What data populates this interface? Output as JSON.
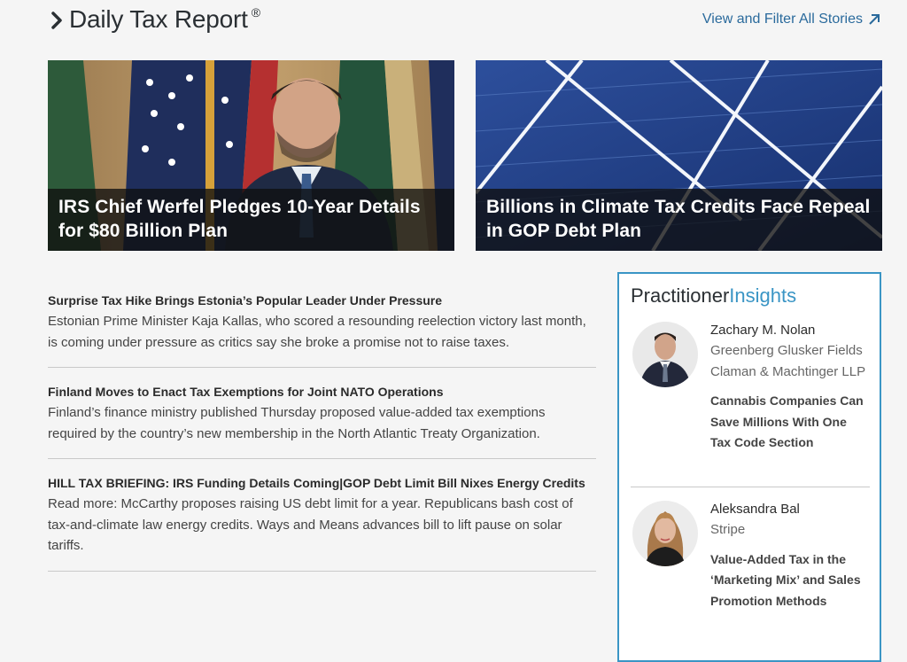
{
  "header": {
    "title": "Daily Tax Report",
    "registered": "®",
    "view_all": "View and Filter All Stories"
  },
  "featured": [
    {
      "headline": "IRS Chief Werfel Pledges 10-Year Details for $80 Billion Plan"
    },
    {
      "headline": "Billions in Climate Tax Credits Face Repeal in GOP Debt Plan"
    }
  ],
  "stories": [
    {
      "title": "Surprise Tax Hike Brings Estonia’s Popular Leader Under Pressure",
      "desc": "Estonian Prime Minister Kaja Kallas, who scored a resounding reelection victory last month, is coming under pressure as critics say she broke a promise not to raise taxes."
    },
    {
      "title": "Finland Moves to Enact Tax Exemptions for Joint NATO Operations",
      "desc": "Finland’s finance ministry published Thursday proposed value-added tax exemptions required by the country’s new membership in the North Atlantic Treaty Organization."
    },
    {
      "title": "HILL TAX BRIEFING: IRS Funding Details Coming|GOP Debt Limit Bill Nixes Energy Credits",
      "desc": "Read more: McCarthy proposes raising US debt limit for a year. Republicans bash cost of tax-and-climate law energy credits. Ways and Means advances bill to lift pause on solar tariffs."
    }
  ],
  "insights": {
    "title_a": "Practitioner",
    "title_b": "Insights",
    "people": [
      {
        "name": "Zachary M. Nolan",
        "org": "Greenberg Glusker Fields Claman & Machtinger LLP",
        "article": "Cannabis Companies Can Save Millions With One Tax Code Section"
      },
      {
        "name": "Aleksandra Bal",
        "org": "Stripe",
        "article": "Value-Added Tax in the ‘Marketing Mix’ and Sales Promotion Methods"
      }
    ]
  },
  "colors": {
    "accent": "#3a95c5",
    "link": "#2a6a9c",
    "caption_bg": "#0f0f0f"
  }
}
